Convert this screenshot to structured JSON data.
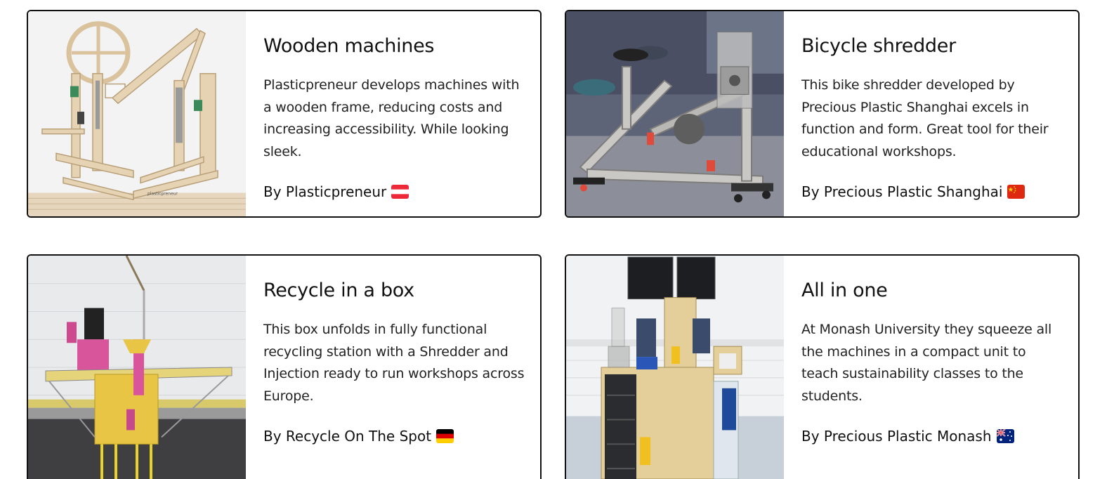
{
  "cards": [
    {
      "title": "Wooden machines",
      "description": "Plasticpreneur develops machines with a wooden frame, reducing costs and increasing accessibility. While looking sleek.",
      "byline": "By Plasticpreneur",
      "flag": "austria-flag-icon",
      "photo_text": "plasticpreneur"
    },
    {
      "title": "Bicycle shredder",
      "description": "This bike shredder developed by Precious Plastic Shanghai excels in function and form. Great tool for their educational workshops.",
      "byline": "By Precious Plastic Shanghai",
      "flag": "china-flag-icon"
    },
    {
      "title": "Recycle in a box",
      "description": "This box unfolds in fully functional recycling station with a Shredder and Injection ready to run workshops across Europe.",
      "byline": "By Recycle On The Spot",
      "flag": "germany-flag-icon"
    },
    {
      "title": "All in one",
      "description": "At Monash University they squeeze all the machines in a compact unit to teach sustainability classes to the students.",
      "byline": "By Precious Plastic Monash",
      "flag": "australia-flag-icon"
    }
  ],
  "colors": {
    "card_border": "#111111",
    "wood": "#e2cfb0",
    "yellow_box": "#e8c545",
    "pink": "#d9559b",
    "plywood": "#e4cf9a"
  }
}
